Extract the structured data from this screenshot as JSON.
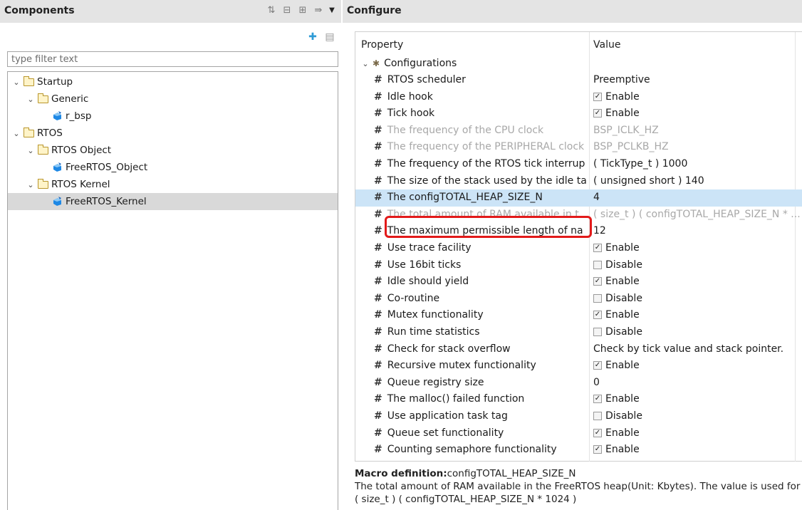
{
  "components_panel": {
    "title": "Components",
    "filter_placeholder": "type filter text",
    "tree": [
      {
        "label": "Startup",
        "kind": "folder",
        "level": 0,
        "expanded": true
      },
      {
        "label": "Generic",
        "kind": "folder",
        "level": 1,
        "expanded": true
      },
      {
        "label": "r_bsp",
        "kind": "component",
        "level": 2
      },
      {
        "label": "RTOS",
        "kind": "folder",
        "level": 0,
        "expanded": true
      },
      {
        "label": "RTOS Object",
        "kind": "folder",
        "level": 1,
        "expanded": true
      },
      {
        "label": "FreeRTOS_Object",
        "kind": "component",
        "level": 2
      },
      {
        "label": "RTOS Kernel",
        "kind": "folder",
        "level": 1,
        "expanded": true
      },
      {
        "label": "FreeRTOS_Kernel",
        "kind": "component",
        "level": 2,
        "selected": true
      }
    ]
  },
  "configure_panel": {
    "title": "Configure",
    "columns": {
      "property": "Property",
      "value": "Value"
    },
    "group_label": "Configurations",
    "rows": [
      {
        "property": "RTOS scheduler",
        "value": "Preemptive",
        "checkbox": null,
        "disabled": false
      },
      {
        "property": "Idle hook",
        "value": "Enable",
        "checkbox": true,
        "disabled": false
      },
      {
        "property": "Tick hook",
        "value": "Enable",
        "checkbox": true,
        "disabled": false
      },
      {
        "property": "The frequency of the CPU clock",
        "value": "BSP_ICLK_HZ",
        "checkbox": null,
        "disabled": true
      },
      {
        "property": "The frequency of the PERIPHERAL clock",
        "value": "BSP_PCLKB_HZ",
        "checkbox": null,
        "disabled": true
      },
      {
        "property": "The frequency of the RTOS tick interrup",
        "value": "( TickType_t ) 1000",
        "checkbox": null,
        "disabled": false
      },
      {
        "property": "The size of the stack used by the idle ta",
        "value": "( unsigned short ) 140",
        "checkbox": null,
        "disabled": false
      },
      {
        "property": "The configTOTAL_HEAP_SIZE_N",
        "value": "4",
        "checkbox": null,
        "disabled": false,
        "highlighted": true
      },
      {
        "property": "The total amount of RAM available in t",
        "value": "( size_t ) ( configTOTAL_HEAP_SIZE_N * ...",
        "checkbox": null,
        "disabled": true
      },
      {
        "property": "The maximum permissible length of na",
        "value": "12",
        "checkbox": null,
        "disabled": false
      },
      {
        "property": "Use trace facility",
        "value": "Enable",
        "checkbox": true,
        "disabled": false
      },
      {
        "property": "Use 16bit ticks",
        "value": "Disable",
        "checkbox": false,
        "disabled": false
      },
      {
        "property": "Idle should yield",
        "value": "Enable",
        "checkbox": true,
        "disabled": false
      },
      {
        "property": "Co-routine",
        "value": "Disable",
        "checkbox": false,
        "disabled": false
      },
      {
        "property": "Mutex functionality",
        "value": "Enable",
        "checkbox": true,
        "disabled": false
      },
      {
        "property": "Run time statistics",
        "value": "Disable",
        "checkbox": false,
        "disabled": false
      },
      {
        "property": "Check for stack overflow",
        "value": "Check by tick value and stack pointer.",
        "checkbox": null,
        "disabled": false
      },
      {
        "property": "Recursive mutex functionality",
        "value": "Enable",
        "checkbox": true,
        "disabled": false
      },
      {
        "property": "Queue registry size",
        "value": "0",
        "checkbox": null,
        "disabled": false
      },
      {
        "property": "The malloc() failed function",
        "value": "Enable",
        "checkbox": true,
        "disabled": false
      },
      {
        "property": "Use application task tag",
        "value": "Disable",
        "checkbox": false,
        "disabled": false
      },
      {
        "property": "Queue set functionality",
        "value": "Enable",
        "checkbox": true,
        "disabled": false
      },
      {
        "property": "Counting semaphore functionality",
        "value": "Enable",
        "checkbox": true,
        "disabled": false
      }
    ],
    "description": {
      "heading_label": "Macro definition:",
      "heading_value": "configTOTAL_HEAP_SIZE_N",
      "line1": "The total amount of RAM available in the FreeRTOS heap(Unit: Kbytes). The value is used for",
      "line2": "( size_t ) ( configTOTAL_HEAP_SIZE_N * 1024 )"
    }
  },
  "colors": {
    "header_bg": "#e4e4e4",
    "selection_bg": "#d9d9d9",
    "highlight_row": "#cce4f7",
    "red_annotation": "#e21a1a",
    "folder": "#b9962c",
    "component_icon": "#1e88e5"
  },
  "icons": {
    "toolbar": [
      "sort-icon",
      "collapse-all-icon",
      "expand-all-icon",
      "link-icon",
      "view-menu-icon"
    ],
    "sub_toolbar": [
      "add-component-icon",
      "remove-component-icon"
    ]
  }
}
